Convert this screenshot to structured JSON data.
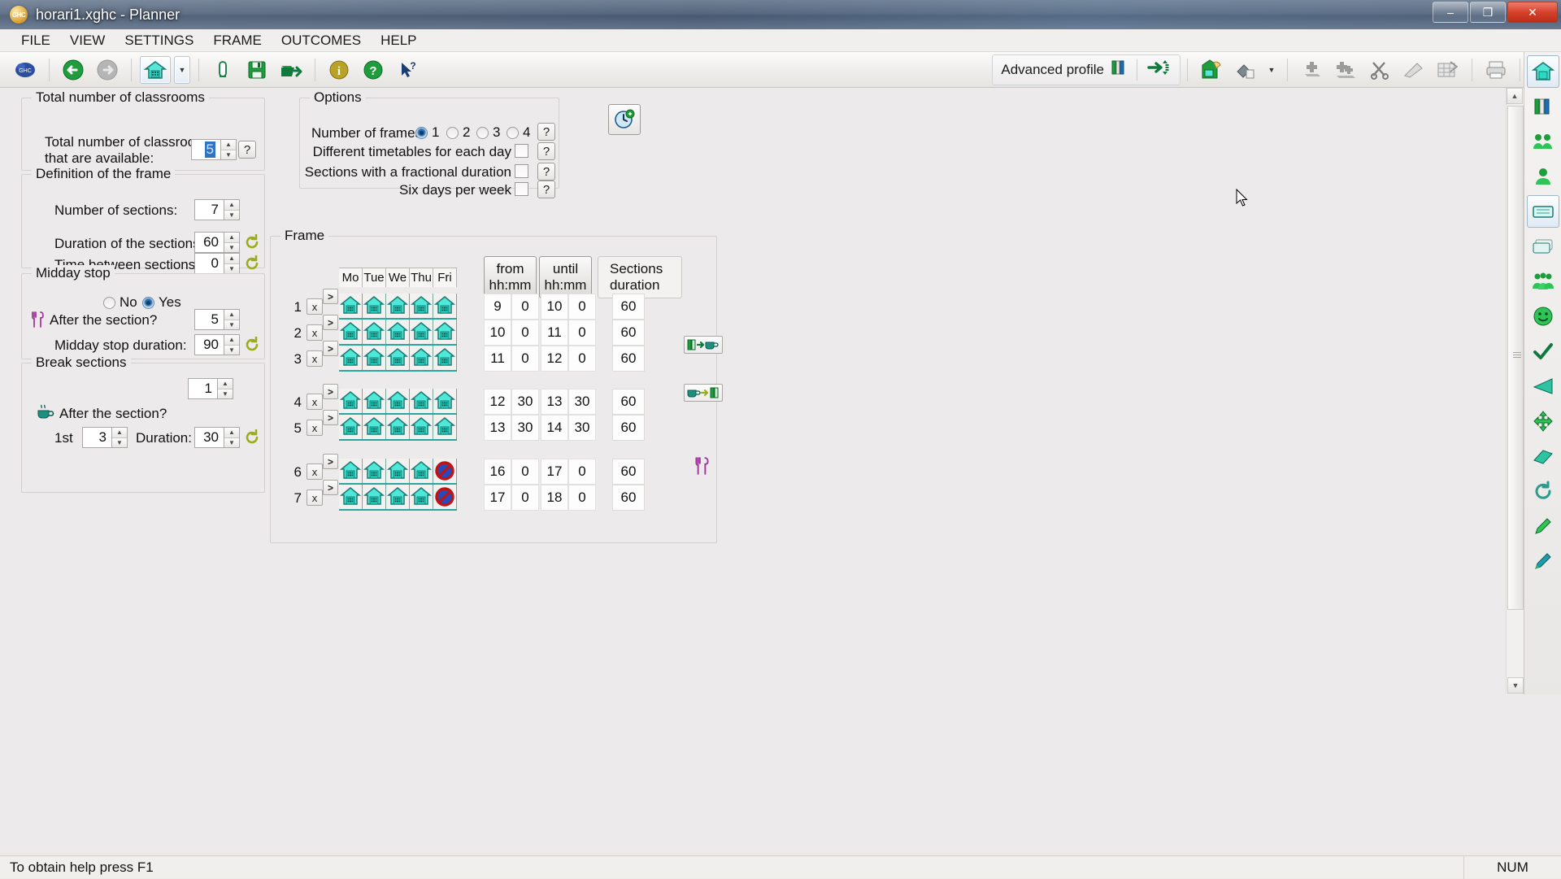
{
  "window": {
    "title": "horari1.xghc - Planner",
    "app_icon": "ghc-logo-icon",
    "minimize": "–",
    "maximize": "❐",
    "close": "✕"
  },
  "menubar": {
    "items": [
      "FILE",
      "VIEW",
      "SETTINGS",
      "FRAME",
      "OUTCOMES",
      "HELP"
    ]
  },
  "toolbar": {
    "logo_label": "GHC",
    "buttons": [
      {
        "name": "back-icon",
        "glyph": "←"
      },
      {
        "name": "forward-icon",
        "glyph": "→"
      },
      {
        "name": "home-frame-icon",
        "glyph": "⌂"
      },
      {
        "name": "dropdown-arrow-icon",
        "glyph": "▼"
      },
      {
        "name": "new-document-icon",
        "glyph": "▯"
      },
      {
        "name": "save-icon",
        "glyph": "▤"
      },
      {
        "name": "open-export-icon",
        "glyph": "➧"
      },
      {
        "name": "info-icon",
        "glyph": "i"
      },
      {
        "name": "help-icon",
        "glyph": "?"
      },
      {
        "name": "context-help-icon",
        "glyph": "?"
      }
    ],
    "advanced_profile_label": "Advanced profile",
    "right_buttons": [
      {
        "name": "goto-arrow-icon",
        "glyph": "➜"
      },
      {
        "name": "assign-hand-icon",
        "glyph": "✍"
      },
      {
        "name": "eraser-icon",
        "glyph": "◧"
      },
      {
        "name": "eraser-dropdown-icon",
        "glyph": "▼"
      },
      {
        "name": "add-piece-icon",
        "glyph": "✛"
      },
      {
        "name": "add-pieces-icon",
        "glyph": "✛"
      },
      {
        "name": "cut-icon",
        "glyph": "✂"
      },
      {
        "name": "wipe-icon",
        "glyph": "◿"
      },
      {
        "name": "grid-tool-icon",
        "glyph": "▦"
      },
      {
        "name": "print-icon",
        "glyph": "🖶"
      },
      {
        "name": "run-icon",
        "glyph": "▶"
      }
    ]
  },
  "rail": {
    "items": [
      {
        "name": "rail-frame-icon",
        "glyph": "▦",
        "selected": false
      },
      {
        "name": "rail-books-icon",
        "glyph": "📗",
        "selected": false
      },
      {
        "name": "rail-groups-icon",
        "glyph": "👥",
        "selected": false
      },
      {
        "name": "rail-teacher-icon",
        "glyph": "👤",
        "selected": false
      },
      {
        "name": "rail-classroom-icon",
        "glyph": "▭",
        "selected": true
      },
      {
        "name": "rail-classrooms-icon",
        "glyph": "❑",
        "selected": false
      },
      {
        "name": "rail-people-icon",
        "glyph": "👪",
        "selected": false
      },
      {
        "name": "rail-smiley-icon",
        "glyph": "☺",
        "selected": false
      },
      {
        "name": "rail-check-icon",
        "glyph": "✔",
        "selected": false
      },
      {
        "name": "rail-cone-icon",
        "glyph": "◣",
        "selected": false
      },
      {
        "name": "rail-move-icon",
        "glyph": "✥",
        "selected": false
      },
      {
        "name": "rail-eraser-icon",
        "glyph": "▰",
        "selected": false
      },
      {
        "name": "rail-refresh-icon",
        "glyph": "↻",
        "selected": false
      },
      {
        "name": "rail-pen-icon",
        "glyph": "✎",
        "selected": false
      },
      {
        "name": "rail-pencil-icon",
        "glyph": "✏",
        "selected": false
      }
    ]
  },
  "classrooms_group": {
    "title": "Total number of classrooms",
    "label_line1": "Total number of classrooms",
    "label_line2": "that are available:",
    "value": "5",
    "help": "?"
  },
  "frame_definition_group": {
    "title": "Definition of the frame",
    "number_of_sections_label": "Number of sections:",
    "number_of_sections_value": "7",
    "duration_label": "Duration of the sections:",
    "duration_value": "60",
    "time_between_label": "Time between sections:",
    "time_between_value": "0"
  },
  "midday_group": {
    "title": "Midday stop",
    "no_label": "No",
    "yes_label": "Yes",
    "selected": "Yes",
    "after_section_label": "After the section?",
    "after_section_value": "5",
    "duration_label": "Midday stop duration:",
    "duration_value": "90",
    "cutlery_icon": "cutlery-icon"
  },
  "break_group": {
    "title": "Break sections",
    "count_value": "1",
    "after_section_label": "After the section?",
    "first_label": "1st",
    "first_value": "3",
    "duration_label": "Duration:",
    "duration_value": "30",
    "coffee_icon": "coffee-cup-icon"
  },
  "options_group": {
    "title": "Options",
    "number_of_frames_label": "Number of frames:",
    "frames_options": [
      "1",
      "2",
      "3",
      "4"
    ],
    "frames_selected": "1",
    "checkboxes": [
      {
        "label": "Different timetables for each day",
        "checked": false
      },
      {
        "label": "Sections with a fractional duration",
        "checked": false
      },
      {
        "label": "Six days per week",
        "checked": false
      }
    ],
    "help": "?"
  },
  "clock_button": {
    "name": "clock-settings-icon",
    "glyph": "🕐"
  },
  "frame_group": {
    "title": "Frame",
    "day_headers": [
      "Mo",
      "Tue",
      "We",
      "Thu",
      "Fri"
    ],
    "col_from": "from\nhh:mm",
    "col_from_line1": "from",
    "col_from_line2": "hh:mm",
    "col_until_line1": "until",
    "col_until_line2": "hh:mm",
    "col_duration_line1": "Sections",
    "col_duration_line2": "duration",
    "delete_glyph": "x",
    "expand_glyph": ">",
    "rows": [
      {
        "num": "1",
        "days": [
          "house",
          "house",
          "house",
          "house",
          "house"
        ],
        "from_h": "9",
        "from_m": "0",
        "until_h": "10",
        "until_m": "0",
        "duration": "60"
      },
      {
        "num": "2",
        "days": [
          "house",
          "house",
          "house",
          "house",
          "house"
        ],
        "from_h": "10",
        "from_m": "0",
        "until_h": "11",
        "until_m": "0",
        "duration": "60"
      },
      {
        "num": "3",
        "days": [
          "house",
          "house",
          "house",
          "house",
          "house"
        ],
        "from_h": "11",
        "from_m": "0",
        "until_h": "12",
        "until_m": "0",
        "duration": "60"
      },
      {
        "num": "4",
        "days": [
          "house",
          "house",
          "house",
          "house",
          "house"
        ],
        "from_h": "12",
        "from_m": "30",
        "until_h": "13",
        "until_m": "30",
        "duration": "60"
      },
      {
        "num": "5",
        "days": [
          "house",
          "house",
          "house",
          "house",
          "house"
        ],
        "from_h": "13",
        "from_m": "30",
        "until_h": "14",
        "until_m": "30",
        "duration": "60"
      },
      {
        "num": "6",
        "days": [
          "house",
          "house",
          "house",
          "house",
          "forbidden"
        ],
        "from_h": "16",
        "from_m": "0",
        "until_h": "17",
        "until_m": "0",
        "duration": "60"
      },
      {
        "num": "7",
        "days": [
          "house",
          "house",
          "house",
          "house",
          "forbidden"
        ],
        "from_h": "17",
        "from_m": "0",
        "until_h": "18",
        "until_m": "0",
        "duration": "60"
      }
    ],
    "side_markers": [
      {
        "name": "book-to-coffee-icon",
        "after_row": 2
      },
      {
        "name": "coffee-to-book-icon",
        "after_row": 3
      },
      {
        "name": "cutlery-marker-icon",
        "after_row": 5
      }
    ]
  },
  "statusbar": {
    "text": "To obtain help press F1",
    "num_indicator": "NUM"
  },
  "colors": {
    "accent_blue": "#2f72c8",
    "house_teal": "#2fe0cf",
    "house_outline": "#1d7a74",
    "forbidden_red": "#cc1111",
    "forbidden_blue": "#2a49b8",
    "green": "#0f7a3d",
    "titlebar": "#53647c"
  }
}
